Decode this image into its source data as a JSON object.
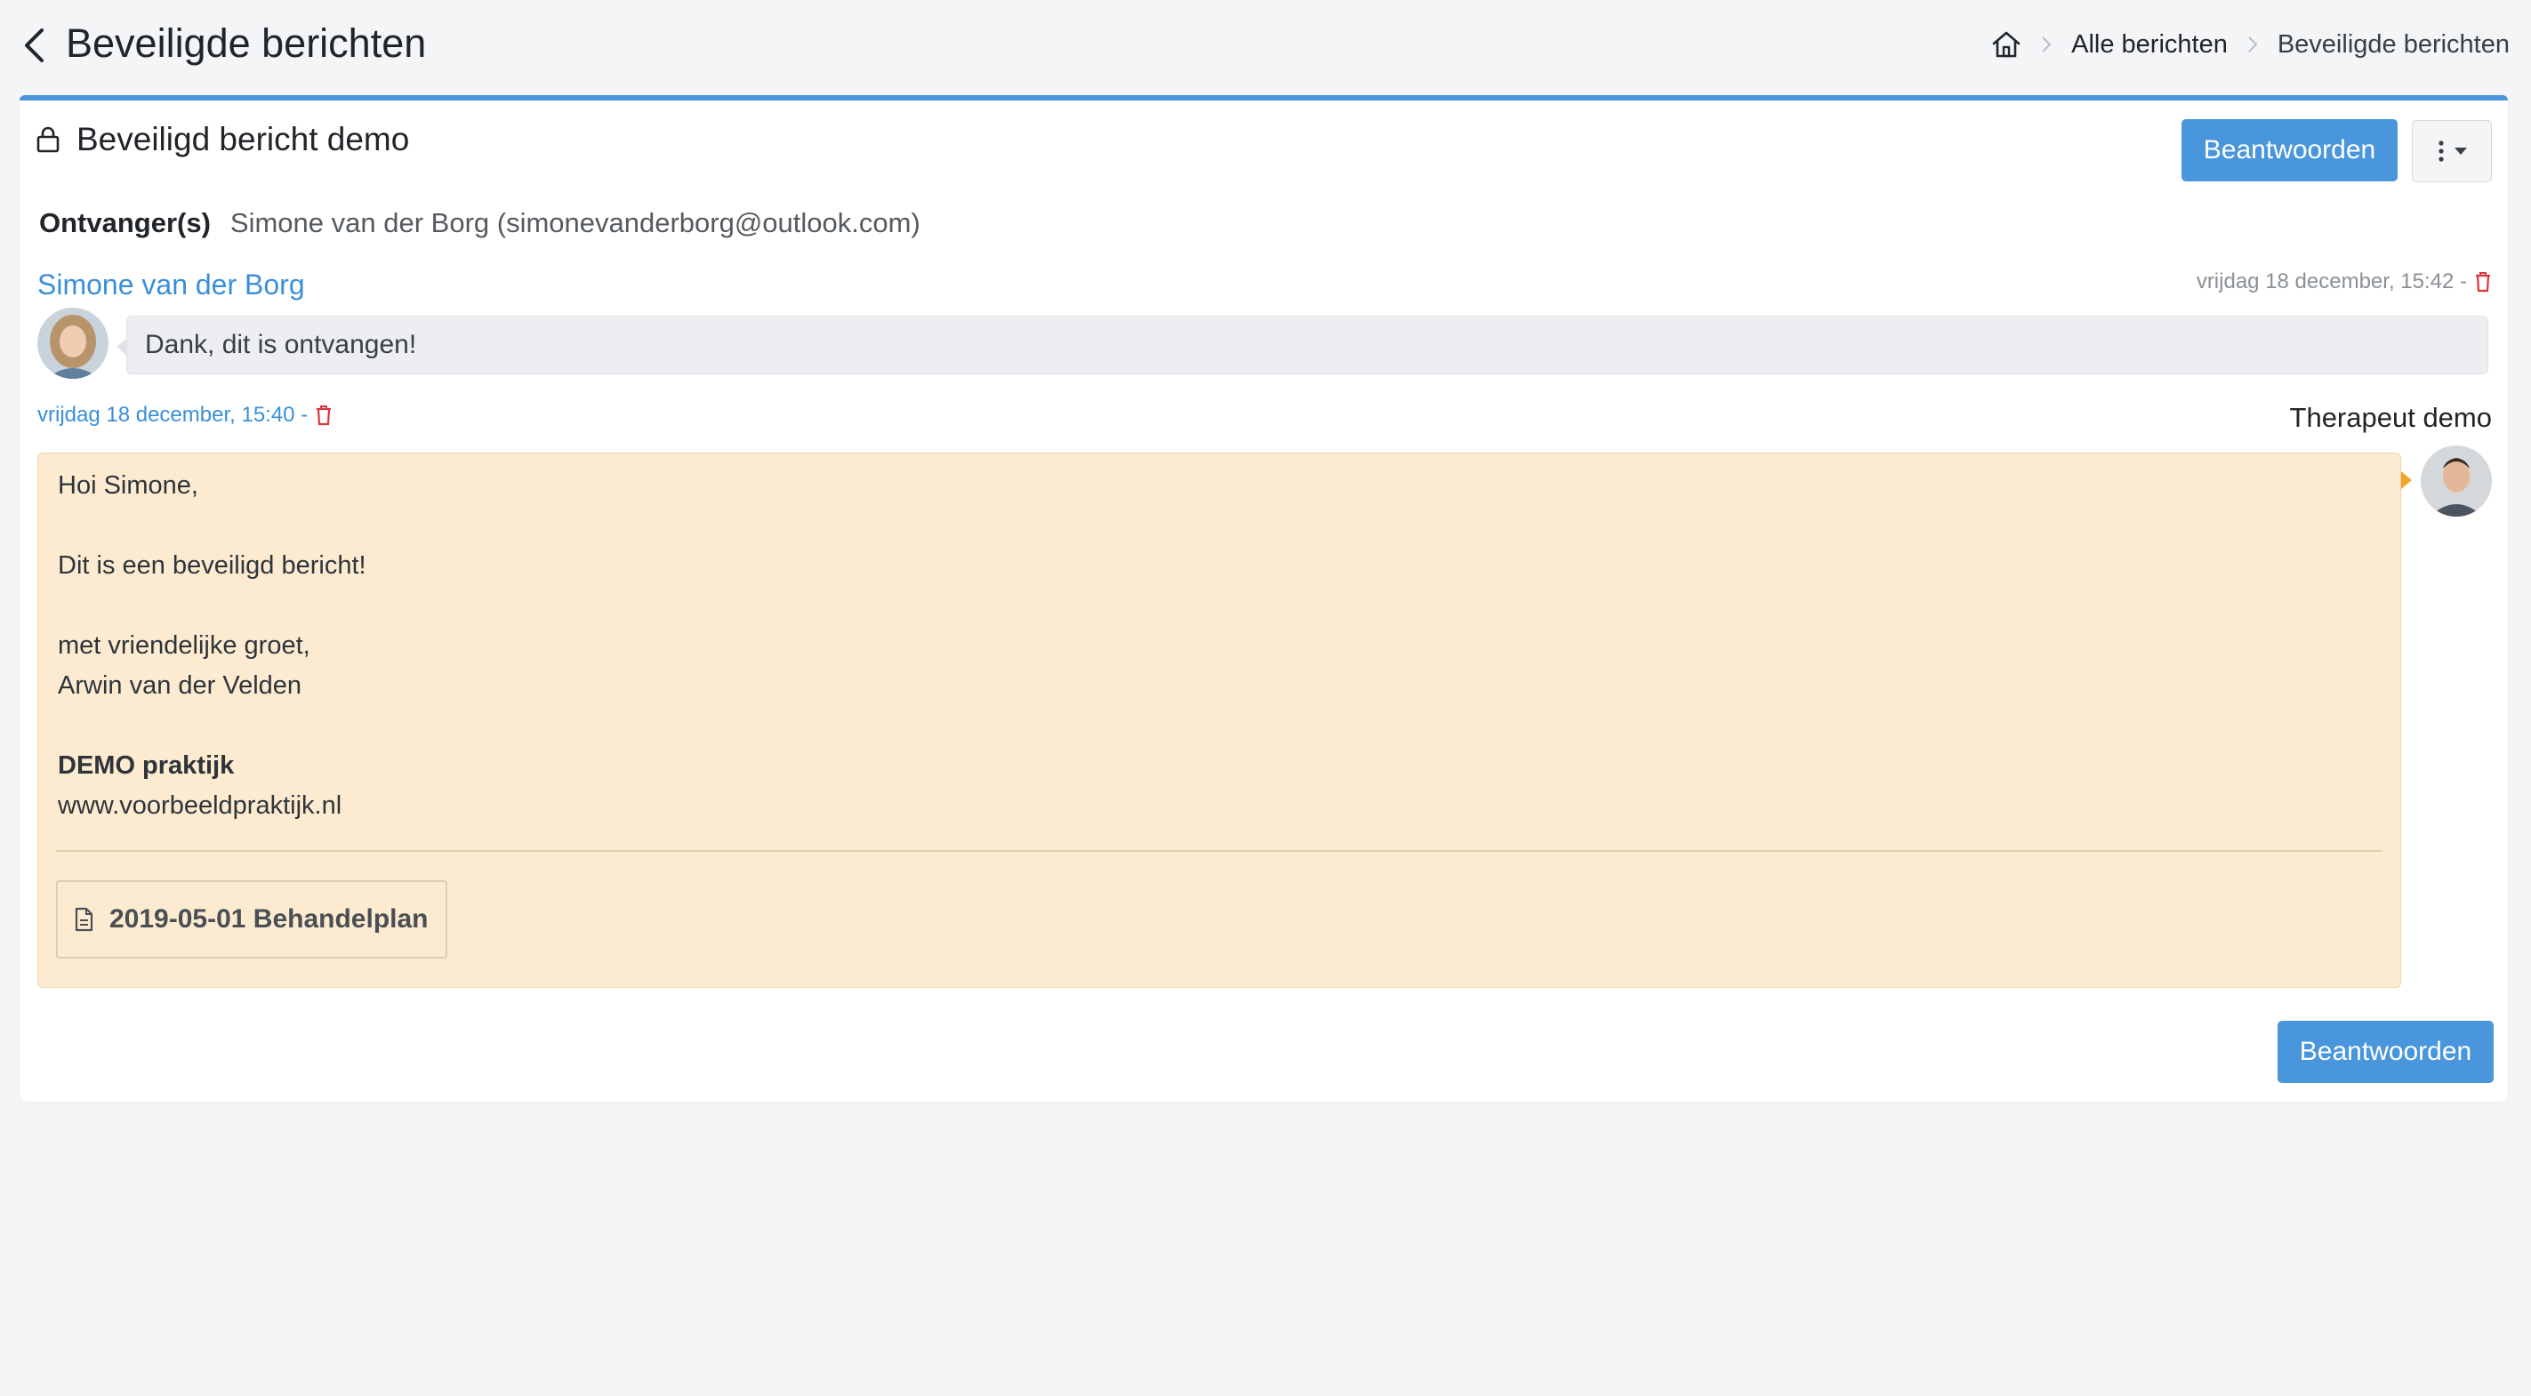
{
  "header": {
    "title": "Beveiligde berichten",
    "breadcrumb": {
      "home_icon": "home-icon",
      "items": [
        "Alle berichten",
        "Beveiligde berichten"
      ]
    }
  },
  "card": {
    "title": "Beveiligd bericht demo",
    "title_icon": "lock-icon",
    "reply_label": "Beantwoorden",
    "menu_icon": "dots-vertical-icon",
    "recipients_label": "Ontvanger(s)",
    "recipients_value": "Simone van der Borg (simonevanderborg@outlook.com)"
  },
  "messages": [
    {
      "sender": "Simone van der Borg",
      "timestamp": "vrijdag 18 december, 15:42 -",
      "text": "Dank, dit is ontvangen!"
    },
    {
      "sender": "Therapeut demo",
      "timestamp": "vrijdag 18 december, 15:40 -",
      "lines": {
        "greeting": "Hoi Simone,",
        "body": "Dit is een beveiligd bericht!",
        "closing": "met vriendelijke groet,",
        "name": "Arwin van der Velden",
        "org": "DEMO praktijk",
        "website": "www.voorbeeldpraktijk.nl"
      },
      "attachment": {
        "icon": "document-icon",
        "label": "2019-05-01 Behandelplan"
      }
    }
  ],
  "footer": {
    "reply_label": "Beantwoorden"
  },
  "colors": {
    "accent": "#4a96dc",
    "link": "#3b8fd8",
    "delete": "#d9363e",
    "outgoing_bubble": "#fcebd1",
    "incoming_bubble": "#eceef2"
  }
}
